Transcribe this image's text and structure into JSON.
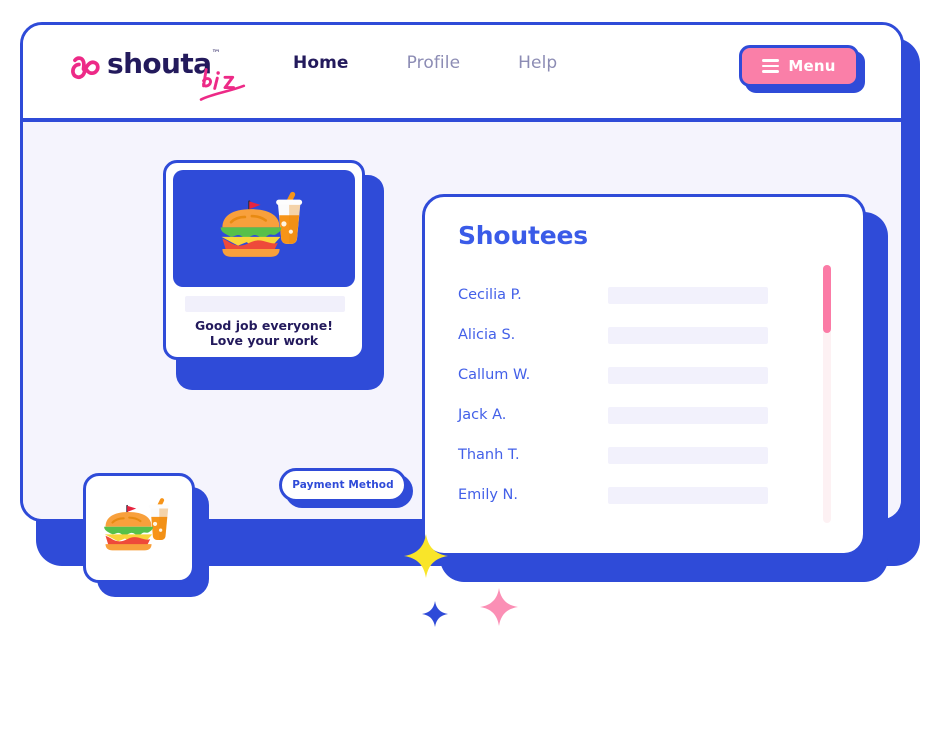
{
  "brand": {
    "logo_word": "shouta",
    "logo_suffix": "biz",
    "logo_tm": "™",
    "logo_mark_icon": "heart-squiggle-icon"
  },
  "nav": {
    "items": [
      {
        "label": "Home",
        "active": true
      },
      {
        "label": "Profile",
        "active": false
      },
      {
        "label": "Help",
        "active": false
      }
    ]
  },
  "menu_button": {
    "label": "Menu",
    "icon": "hamburger-icon"
  },
  "shout_card": {
    "hero_icon": "sandwich-and-drink-icon",
    "message_line1": "Good job everyone!",
    "message_line2": "Love your work"
  },
  "payment_button": {
    "label": "Payment Method"
  },
  "shoutees": {
    "title": "Shoutees",
    "rows": [
      {
        "name": "Cecilia P."
      },
      {
        "name": "Alicia S."
      },
      {
        "name": "Callum W."
      },
      {
        "name": "Jack A."
      },
      {
        "name": "Thanh T."
      },
      {
        "name": "Emily N."
      }
    ],
    "scrollbar": {
      "thumb_position_percent": 0,
      "thumb_size_percent": 26
    }
  },
  "floating_card": {
    "icon": "sandwich-and-drink-icon"
  },
  "decorations": [
    {
      "name": "sparkle-yellow",
      "color": "#F9E529"
    },
    {
      "name": "sparkle-blue",
      "color": "#2F4BD8"
    },
    {
      "name": "sparkle-pink",
      "color": "#FB8FB5"
    }
  ],
  "colors": {
    "brand_blue": "#2F4BD8",
    "brand_pink": "#ED2A87",
    "accent_pink": "#FA7FA8",
    "navy_text": "#231A5C",
    "muted_text": "#8C8CB4",
    "page_bg": "#F5F4FD",
    "placeholder_bar": "#F2F1FC",
    "scrollbar_track": "#FDF1F3",
    "scrollbar_thumb": "#FB7BA6"
  }
}
